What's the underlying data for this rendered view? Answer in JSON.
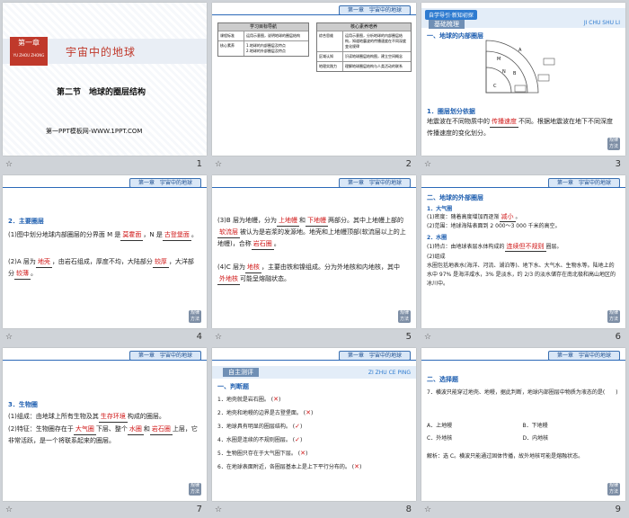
{
  "header_tag": "第一章　宇宙中的地球",
  "corner": "规律 方法",
  "slides": [
    {
      "num": "1",
      "chapter_tag": "第一章",
      "chapter_sub": "YU ZHOU ZHONG",
      "title": "宇宙中的地球",
      "section": "第二节　地球的圈层结构",
      "template": "第一PPT模板网-WWW.1PPT.COM"
    },
    {
      "num": "2",
      "left_head": "学习目标导航",
      "left_rows": [
        "课程标准",
        "核心素养"
      ],
      "left_vals": [
        "运用示意图，说明地球的圈层结构",
        "1.地球的内部圈层及特点",
        "2.地球的外部圈层及特点"
      ],
      "right_head": "核心素养培养",
      "right_rows": [
        "综合思维",
        "区域认知",
        "地理实践力"
      ],
      "right_vals": [
        "运用示意图，分析地球的内部圈层结构，知道地震波的传播速度在不同深度变化规律",
        "识读地球圈层结构图，建立空间概念",
        "理解地球圈层结构与人类活动的联系"
      ]
    },
    {
      "num": "3",
      "tab1": "自学导引·新知初探",
      "tab2": "基础梳理",
      "pinyin": "JI CHU SHU LI",
      "h1": "一、地球的内部圈层",
      "labels": [
        "M",
        "N",
        "A",
        "B",
        "C"
      ],
      "h2": "1．圈层划分依据",
      "p1a": "地震波在不同物质中的",
      "p1fill": "传播速度",
      "p1b": "不同。根据地震波在地下不同深度传播速度的变化划分。"
    },
    {
      "num": "4",
      "h": "2．主要圈层",
      "l1a": "(1)图中划分地球内部圈层的分界面 M 是",
      "l1f": "莫霍面",
      "l1b": "，N 是",
      "l1f2": "古登堡面",
      "l1c": "。",
      "l2a": "(2)A 层为",
      "l2f": "地壳",
      "l2b": "，由岩石组成，厚度不均，大陆部分",
      "l2f2": "较厚",
      "l2c": "，大洋部分",
      "l2f3": "较薄",
      "l2d": "。"
    },
    {
      "num": "5",
      "l1a": "(3)B 层为地幔，分为",
      "l1f": "上地幔",
      "l1b": "和",
      "l1f2": "下地幔",
      "l1c": "两部分。其中上地幔上部的",
      "l1f3": "软流层",
      "l1d": "被认为是岩浆的发源地。地壳和上地幔顶部(软流层以上的上地幔)，合称",
      "l1f4": "岩石圈",
      "l1e": "。",
      "l2a": "(4)C 层为",
      "l2f": "地核",
      "l2b": "，主要由铁和镍组成。分为外地核和内地核，其中",
      "l2f2": "外地核",
      "l2c": "可能呈熔融状态。"
    },
    {
      "num": "6",
      "h": "二、地球的外部圈层",
      "s1": "1．大气圈",
      "s1a": "(1)密度：随着高度增加而逐渐",
      "s1f": "减小",
      "s1b": "。",
      "s1c": "(2)范围：地球海陆表面到 2 000～3 000 千米的高空。",
      "s2": "2．水圈",
      "s2a": "(1)特点：由地球表层水体构成的",
      "s2f": "连续但不规则",
      "s2b": "圈层。",
      "s2c": "(2)组成",
      "s2d": "水圈包括地表水(海洋、河流、湖泊等)、地下水、大气水、生物水等。陆地上的水中 97% 是海洋咸水，3% 是淡水，约 2/3 的淡水储存在南北极和高山地区的冰川中。"
    },
    {
      "num": "7",
      "s": "3．生物圈",
      "l1a": "(1)组成：由地球上所有生物及其",
      "l1f": "生存环境",
      "l1b": "构成的圈层。",
      "l2a": "(2)特征：生物圈存在于",
      "l2f": "大气圈",
      "l2b": "下层、整个",
      "l2f2": "水圈",
      "l2c": "和",
      "l2f3": "岩石圈",
      "l2d": "上层，它非常活跃，是一个将联系起来的圈层。"
    },
    {
      "num": "8",
      "tab": "自主测评",
      "pinyin": "ZI ZHU CE PING",
      "h": "一、判断题",
      "items": [
        {
          "t": "1．地壳就是岩石圈。",
          "m": "✕"
        },
        {
          "t": "2．地壳和地幔的边界是古登堡面。",
          "m": "✕"
        },
        {
          "t": "3．地球具有明显的圈层结构。",
          "m": "✓"
        },
        {
          "t": "4．水圈是连续的不规则圈层。",
          "m": "✓"
        },
        {
          "t": "5．生物圈只存在于大气圈下层。",
          "m": "✕"
        },
        {
          "t": "6．在地球表面附近，各圈层基本上是上下平行分布的。",
          "m": "✕"
        }
      ]
    },
    {
      "num": "9",
      "h": "二、选择题",
      "q": "7．横波只能穿过地壳、地幔，据此判断，地球内部圈层中物质为液态的是(　　)",
      "opts": [
        "A．上地幔",
        "B．下地幔",
        "C．外地核",
        "D．内地核"
      ],
      "ans": "解析：选 C。横波只能通过固体传播，故外地核可能是熔融状态。"
    }
  ]
}
